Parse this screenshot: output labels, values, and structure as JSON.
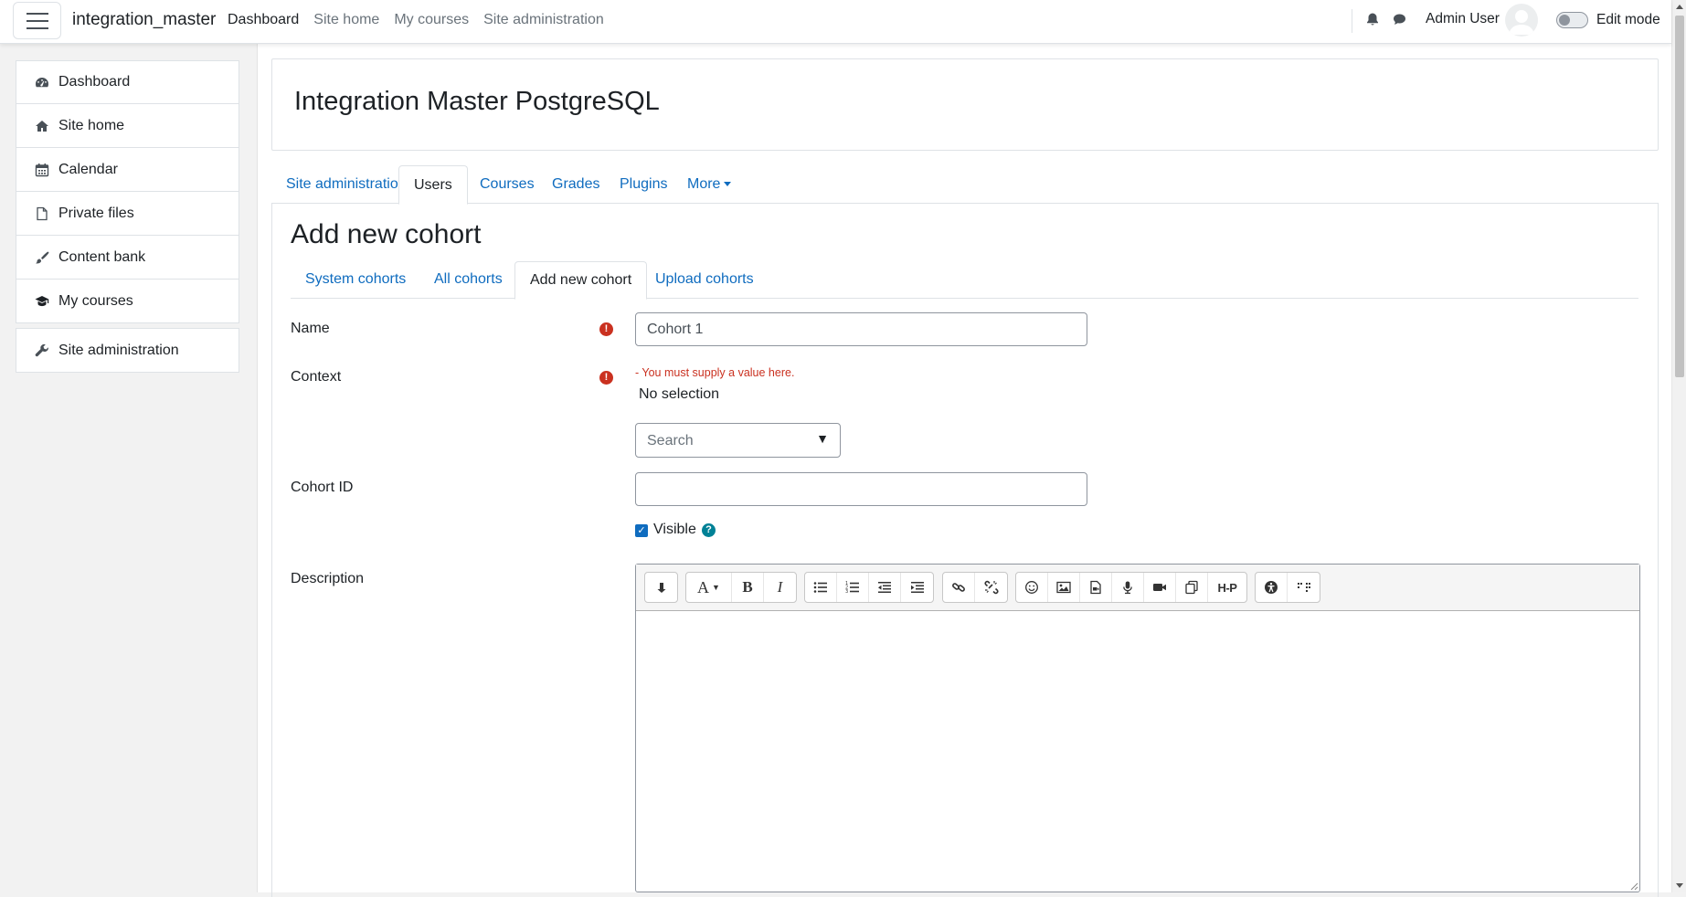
{
  "navbar": {
    "site_name": "integration_master",
    "primary": [
      {
        "label": "Dashboard"
      },
      {
        "label": "Site home"
      },
      {
        "label": "My courses"
      },
      {
        "label": "Site administration"
      }
    ],
    "user_name": "Admin User",
    "edit_mode_label": "Edit mode",
    "icons": [
      "menu-icon",
      "bell-icon",
      "chat-icon",
      "avatar",
      "toggle"
    ]
  },
  "drawer": {
    "items": [
      {
        "label": "Dashboard",
        "icon": "dashboard-icon"
      },
      {
        "label": "Site home",
        "icon": "home-icon"
      },
      {
        "label": "Calendar",
        "icon": "calendar-icon"
      },
      {
        "label": "Private files",
        "icon": "file-icon"
      },
      {
        "label": "Content bank",
        "icon": "brush-icon"
      },
      {
        "label": "My courses",
        "icon": "graduation-cap-icon"
      }
    ],
    "admin_item": {
      "label": "Site administration",
      "icon": "wrench-icon"
    }
  },
  "header": {
    "title": "Integration Master PostgreSQL"
  },
  "secondary_nav": {
    "tabs": [
      "Site administration",
      "Users",
      "Courses",
      "Grades",
      "Plugins"
    ],
    "more_label": "More"
  },
  "page": {
    "title": "Add new cohort",
    "cohort_tabs": [
      "System cohorts",
      "All cohorts",
      "Add new cohort",
      "Upload cohorts"
    ]
  },
  "form": {
    "name_label": "Name",
    "name_value": "Cohort 1",
    "context_label": "Context",
    "context_error": "- You must supply a value here.",
    "context_selection": "No selection",
    "context_search_placeholder": "Search",
    "cohort_id_label": "Cohort ID",
    "cohort_id_value": "",
    "visible_label": "Visible",
    "visible_checked": true,
    "description_label": "Description"
  },
  "editor_toolbar": {
    "groups": [
      [
        "show-more-icon"
      ],
      [
        "font-style-icon",
        "bold-icon",
        "italic-icon"
      ],
      [
        "unordered-list-icon",
        "ordered-list-icon",
        "outdent-icon",
        "indent-icon"
      ],
      [
        "link-icon",
        "unlink-icon"
      ],
      [
        "emoji-icon",
        "image-icon",
        "media-icon",
        "record-audio-icon",
        "record-video-icon",
        "manage-files-icon",
        "h5p-icon"
      ],
      [
        "accessibility-checker-icon",
        "screenreader-helper-icon"
      ]
    ]
  },
  "colors": {
    "link": "#0f6cbf",
    "error": "#ca3120",
    "help": "#008196",
    "text": "#1d2125"
  }
}
